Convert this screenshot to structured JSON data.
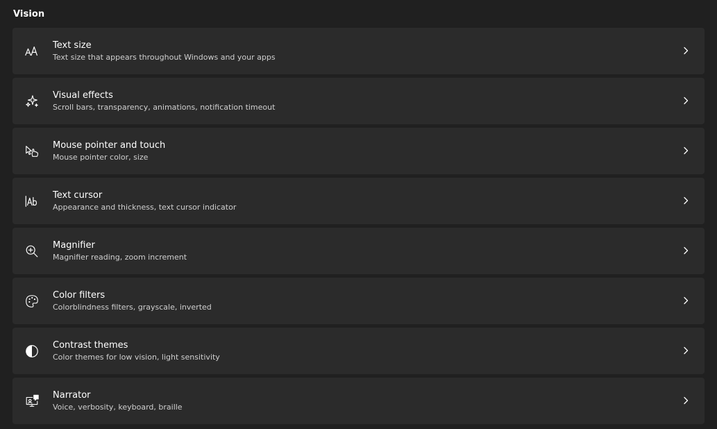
{
  "section": {
    "title": "Vision"
  },
  "items": [
    {
      "title": "Text size",
      "description": "Text size that appears throughout Windows and your apps",
      "icon": "text-size-icon"
    },
    {
      "title": "Visual effects",
      "description": "Scroll bars, transparency, animations, notification timeout",
      "icon": "sparkle-icon"
    },
    {
      "title": "Mouse pointer and touch",
      "description": "Mouse pointer color, size",
      "icon": "pointer-touch-icon"
    },
    {
      "title": "Text cursor",
      "description": "Appearance and thickness, text cursor indicator",
      "icon": "text-cursor-icon"
    },
    {
      "title": "Magnifier",
      "description": "Magnifier reading, zoom increment",
      "icon": "magnifier-icon"
    },
    {
      "title": "Color filters",
      "description": "Colorblindness filters, grayscale, inverted",
      "icon": "palette-icon"
    },
    {
      "title": "Contrast themes",
      "description": "Color themes for low vision, light sensitivity",
      "icon": "contrast-icon"
    },
    {
      "title": "Narrator",
      "description": "Voice, verbosity, keyboard, braille",
      "icon": "narrator-icon"
    }
  ],
  "colors": {
    "background": "#202020",
    "card": "#2b2b2b",
    "text": "#ffffff",
    "subtext": "#cfcfcf"
  }
}
